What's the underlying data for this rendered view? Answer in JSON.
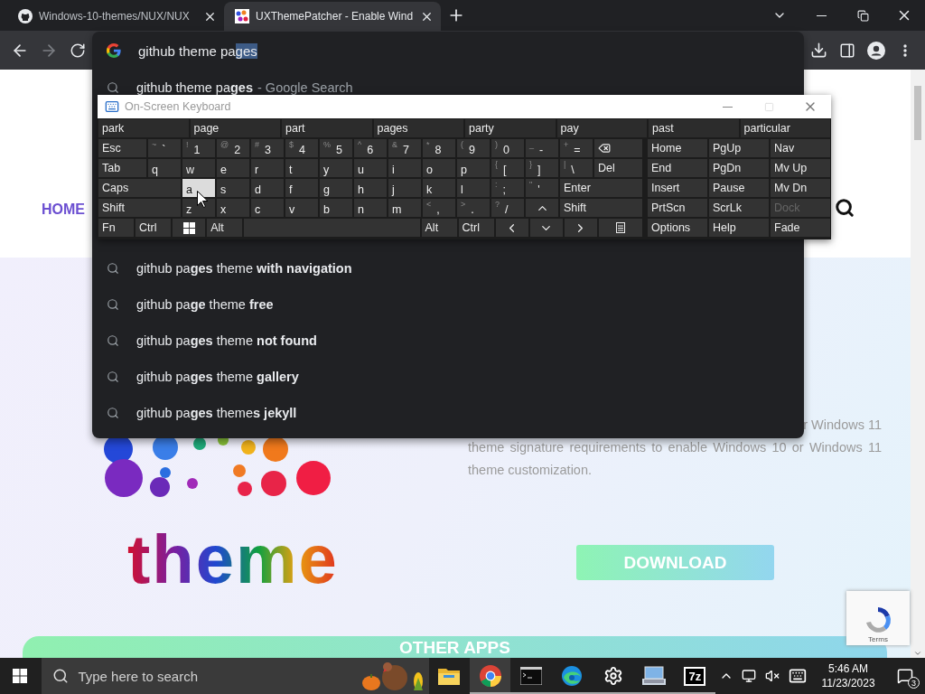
{
  "browser": {
    "tabs": [
      {
        "title": "Windows-10-themes/NUX/NUX",
        "kind": "github",
        "selected": false
      },
      {
        "title": "UXThemePatcher - Enable Wind",
        "kind": "site",
        "selected": true
      }
    ],
    "omnibox": {
      "typed": "github theme pa",
      "completion": "ges"
    },
    "suggestions": [
      {
        "text": "github theme pa**ges**",
        "note": "- Google Search"
      },
      {
        "text": "github pa**ges** theme **with navigation**"
      },
      {
        "text": "github pa**ge** theme **free**"
      },
      {
        "text": "github pa**ges** theme **not found**"
      },
      {
        "text": "github pa**ges** theme **gallery**"
      },
      {
        "text": "github pa**ges** theme**s jekyll**"
      }
    ]
  },
  "page": {
    "nav_items": [
      {
        "label": "HOME"
      }
    ],
    "description": [
      "r Windows 11",
      "theme signature requirements to enable Windows 10 or Windows 11",
      "theme customization."
    ],
    "logo_text": "theme",
    "download": "DOWNLOAD",
    "recaptcha": "Terms",
    "section_title": "OTHER APPS"
  },
  "osk": {
    "title": "On-Screen Keyboard",
    "predictions": [
      "park",
      "page",
      "part",
      "pages",
      "party",
      "pay",
      "past",
      "particular"
    ],
    "rows": [
      {
        "keys": [
          {
            "kind": "named",
            "label": "Esc",
            "selected": false
          },
          {
            "kind": "char",
            "shift": "~",
            "label": "`",
            "selected": false
          },
          {
            "kind": "char",
            "shift": "!",
            "label": "1",
            "selected": false
          },
          {
            "kind": "char",
            "shift": "@",
            "label": "2",
            "selected": false
          },
          {
            "kind": "char",
            "shift": "#",
            "label": "3",
            "selected": false
          },
          {
            "kind": "char",
            "shift": "$",
            "label": "4",
            "selected": false
          },
          {
            "kind": "char",
            "shift": "%",
            "label": "5",
            "selected": false
          },
          {
            "kind": "char",
            "shift": "^",
            "label": "6",
            "selected": false
          },
          {
            "kind": "char",
            "shift": "&",
            "label": "7",
            "selected": false
          },
          {
            "kind": "char",
            "shift": "*",
            "label": "8",
            "selected": false
          },
          {
            "kind": "char",
            "shift": "(",
            "label": "9",
            "selected": false
          },
          {
            "kind": "char",
            "shift": ")",
            "label": "0",
            "selected": false
          },
          {
            "kind": "char",
            "shift": "_",
            "label": "-",
            "selected": false
          },
          {
            "kind": "char",
            "shift": "+",
            "label": "=",
            "selected": false
          },
          {
            "kind": "backspace",
            "selected": false
          }
        ]
      },
      {
        "keys": [
          {
            "kind": "named",
            "label": "Tab",
            "selected": false
          },
          {
            "kind": "char",
            "label": "q",
            "selected": false
          },
          {
            "kind": "char",
            "label": "w",
            "selected": false
          },
          {
            "kind": "char",
            "label": "e",
            "selected": false
          },
          {
            "kind": "char",
            "label": "r",
            "selected": false
          },
          {
            "kind": "char",
            "label": "t",
            "selected": false
          },
          {
            "kind": "char",
            "label": "y",
            "selected": false
          },
          {
            "kind": "char",
            "label": "u",
            "selected": false
          },
          {
            "kind": "char",
            "label": "i",
            "selected": false
          },
          {
            "kind": "char",
            "label": "o",
            "selected": false
          },
          {
            "kind": "char",
            "label": "p",
            "selected": false
          },
          {
            "kind": "char",
            "shift": "{",
            "label": "[",
            "selected": false
          },
          {
            "kind": "char",
            "shift": "}",
            "label": "]",
            "selected": false
          },
          {
            "kind": "char",
            "shift": "|",
            "label": "\\",
            "selected": false
          },
          {
            "kind": "named",
            "label": "Del",
            "selected": false
          }
        ]
      },
      {
        "keys": [
          {
            "kind": "named",
            "label": "Caps",
            "selected": false
          },
          {
            "kind": "char",
            "label": "a",
            "selected": true
          },
          {
            "kind": "char",
            "label": "s",
            "selected": false
          },
          {
            "kind": "char",
            "label": "d",
            "selected": false
          },
          {
            "kind": "char",
            "label": "f",
            "selected": false
          },
          {
            "kind": "char",
            "label": "g",
            "selected": false
          },
          {
            "kind": "char",
            "label": "h",
            "selected": false
          },
          {
            "kind": "char",
            "label": "j",
            "selected": false
          },
          {
            "kind": "char",
            "label": "k",
            "selected": false
          },
          {
            "kind": "char",
            "label": "l",
            "selected": false
          },
          {
            "kind": "char",
            "shift": ":",
            "label": ";",
            "selected": false
          },
          {
            "kind": "char",
            "shift": "\"",
            "label": "'",
            "selected": false
          },
          {
            "kind": "named",
            "label": "Enter",
            "selected": false
          }
        ]
      },
      {
        "keys": [
          {
            "kind": "named",
            "label": "Shift",
            "selected": false
          },
          {
            "kind": "char",
            "label": "z",
            "selected": false
          },
          {
            "kind": "char",
            "label": "x",
            "selected": false
          },
          {
            "kind": "char",
            "label": "c",
            "selected": false
          },
          {
            "kind": "char",
            "label": "v",
            "selected": false
          },
          {
            "kind": "char",
            "label": "b",
            "selected": false
          },
          {
            "kind": "char",
            "label": "n",
            "selected": false
          },
          {
            "kind": "char",
            "label": "m",
            "selected": false
          },
          {
            "kind": "char",
            "shift": "<",
            "label": ",",
            "selected": false
          },
          {
            "kind": "char",
            "shift": ">",
            "label": ".",
            "selected": false
          },
          {
            "kind": "char",
            "shift": "?",
            "label": "/",
            "selected": false
          },
          {
            "kind": "up",
            "selected": false
          },
          {
            "kind": "named",
            "label": "Shift",
            "selected": false
          }
        ]
      },
      {
        "keys": [
          {
            "kind": "named",
            "label": "Fn",
            "selected": false
          },
          {
            "kind": "named",
            "label": "Ctrl",
            "selected": false
          },
          {
            "kind": "windows",
            "selected": false
          },
          {
            "kind": "named",
            "label": "Alt",
            "selected": false
          },
          {
            "kind": "space",
            "selected": false
          },
          {
            "kind": "named",
            "label": "Alt",
            "selected": false
          },
          {
            "kind": "named",
            "label": "Ctrl",
            "selected": false
          },
          {
            "kind": "left",
            "selected": false
          },
          {
            "kind": "down",
            "selected": false
          },
          {
            "kind": "right",
            "selected": false
          },
          {
            "kind": "menu",
            "selected": false
          }
        ]
      }
    ],
    "side": [
      [
        {
          "label": "Home",
          "disabled": false
        },
        {
          "label": "PgUp",
          "disabled": false
        },
        {
          "label": "Nav",
          "disabled": false
        }
      ],
      [
        {
          "label": "End",
          "disabled": false
        },
        {
          "label": "PgDn",
          "disabled": false
        },
        {
          "label": "Mv Up",
          "disabled": false
        }
      ],
      [
        {
          "label": "Insert",
          "disabled": false
        },
        {
          "label": "Pause",
          "disabled": false
        },
        {
          "label": "Mv Dn",
          "disabled": false
        }
      ],
      [
        {
          "label": "PrtScn",
          "disabled": false
        },
        {
          "label": "ScrLk",
          "disabled": false
        },
        {
          "label": "Dock",
          "disabled": true
        }
      ],
      [
        {
          "label": "Options",
          "disabled": false
        },
        {
          "label": "Help",
          "disabled": false
        },
        {
          "label": "Fade",
          "disabled": false
        }
      ]
    ]
  },
  "taskbar": {
    "search_placeholder": "Type here to search",
    "apps": [
      {
        "kind": "explorer",
        "selected": false,
        "running": false
      },
      {
        "kind": "chrome",
        "selected": true,
        "running": true
      },
      {
        "kind": "terminal",
        "selected": false,
        "running": true
      },
      {
        "kind": "edge",
        "selected": false,
        "running": true
      },
      {
        "kind": "settings",
        "selected": false,
        "running": true
      },
      {
        "kind": "keyboard",
        "selected": false,
        "running": true
      },
      {
        "kind": "archiver",
        "label": "7z",
        "selected": false,
        "running": true
      }
    ],
    "time": "5:46 AM",
    "date": "11/23/2023",
    "notifications": "3"
  }
}
